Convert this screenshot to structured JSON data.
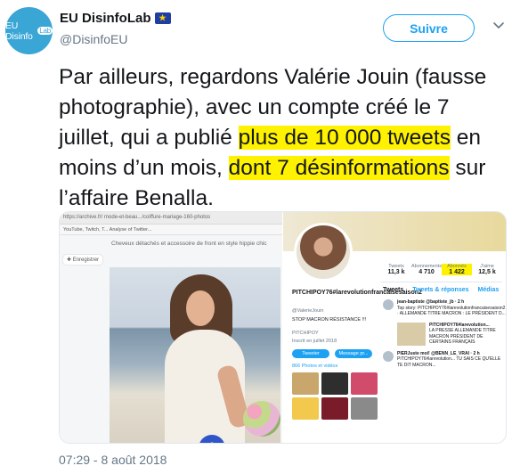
{
  "account": {
    "display_name": "EU DisinfoLab",
    "handle": "@DisinfoEU",
    "avatar_text": "EU Disinfo",
    "avatar_badge": "Lab",
    "flag_icon": "eu-flag-icon"
  },
  "follow_button": {
    "label": "Suivre"
  },
  "menu_icon": "chevron-down-icon",
  "tweet": {
    "text_parts": [
      "Par ailleurs, regardons Valérie Jouin (fausse photographie), avec un compte créé le 7 juillet, qui a publié ",
      "plus de 10 000 tweets",
      " en moins d’un mois, ",
      "dont 7 désinformations",
      " sur l’affaire Benalla."
    ],
    "highlight_color": "#fff200"
  },
  "media": {
    "left": {
      "address": "https://archive.fr/ mode-et-beau.../coiffure-mariage-160-photos",
      "bookmarks": "YouTube, Twitch, T...  Analyse of Twitter...",
      "site_header": "Cheveux détachés et accessoire de front en style hippie chic",
      "save_label": "Enregistrer"
    },
    "right": {
      "stats": [
        {
          "label": "Tweets",
          "value": "11,3 k"
        },
        {
          "label": "Abonnements",
          "value": "4 710"
        },
        {
          "label": "Abonnés",
          "value": "1 422",
          "active": true
        },
        {
          "label": "J'aime",
          "value": "12,5 k"
        }
      ],
      "name": "PITCHIPOY76#larevolutionfrancaisesaison2",
      "handle": "@ValerieJouin",
      "bio": "STOP MACRON RÉSISTANCE !!!",
      "location": "PITCHIPOY",
      "joined": "Inscrit en juillet 2018",
      "tweet_btn": "Tweeter",
      "message_btn": "Message pr...",
      "photos": "866 Photos et vidéos",
      "tabs": [
        "Tweets",
        "Tweets & réponses",
        "Médias"
      ],
      "feed": [
        {
          "author": "jean-baptiste @baptiste_jb · 2 h",
          "text": "Top story: PITCHIPOY76#larevolutionfrancaisesaison2 · ALLEMANDE TITRE MACRON : LE PRÉSIDENT D..."
        },
        {
          "author": "PITCHIPOY76#larevolution...",
          "text": "LA PRESSE ALLEMANDE TITRE MACRON PRÉSIDENT DE CERTAINS FRANÇAIS"
        },
        {
          "author": "PIERJuste moi! @BENN_LE_VRAI · 2 h",
          "text": "PITCHIPOY76#larevolution... TU SAIS CE QU'ELLE TE DIT MACRON..."
        }
      ]
    }
  },
  "timestamp": "07:29 - 8 août 2018"
}
